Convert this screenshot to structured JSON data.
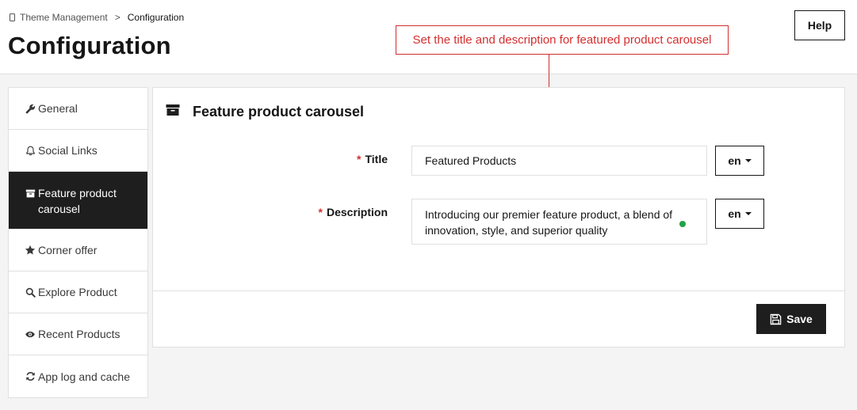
{
  "breadcrumb": {
    "parent": "Theme Management",
    "separator": ">",
    "current": "Configuration"
  },
  "page": {
    "title": "Configuration"
  },
  "header": {
    "help_label": "Help"
  },
  "annotation": {
    "text": "Set the title and description for featured product carousel",
    "color": "#d32f2f"
  },
  "sidebar": {
    "items": [
      {
        "label": "General",
        "icon": "wrench-icon"
      },
      {
        "label": "Social Links",
        "icon": "bell-icon"
      },
      {
        "label": "Feature product carousel",
        "icon": "archive-box-icon",
        "active": true
      },
      {
        "label": "Corner offer",
        "icon": "star-icon"
      },
      {
        "label": "Explore Product",
        "icon": "search-icon"
      },
      {
        "label": "Recent Products",
        "icon": "eye-icon"
      },
      {
        "label": "App log and cache",
        "icon": "refresh-icon"
      }
    ]
  },
  "panel": {
    "title": "Feature product carousel",
    "icon": "archive-box-icon",
    "fields": {
      "title": {
        "required_mark": "*",
        "label": "Title",
        "value": "Featured Products",
        "lang": "en"
      },
      "description": {
        "required_mark": "*",
        "label": "Description",
        "value": "Introducing our premier feature product, a blend of innovation, style, and superior quality",
        "lang": "en"
      }
    },
    "save_label": "Save"
  },
  "colors": {
    "accent_dark": "#1e1e1e",
    "required": "#d32f2f",
    "status_dot": "#24a148"
  }
}
